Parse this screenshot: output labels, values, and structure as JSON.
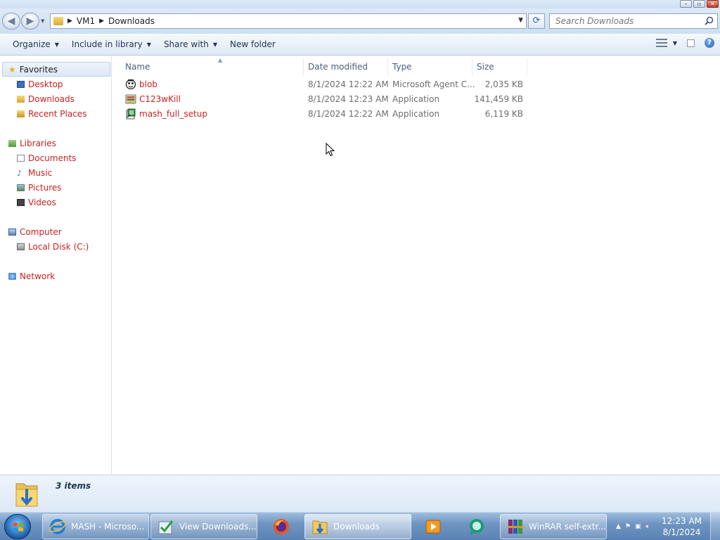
{
  "address": {
    "crumbs": [
      "VM1",
      "Downloads"
    ]
  },
  "search": {
    "placeholder": "Search Downloads"
  },
  "toolbar": {
    "organize": "Organize",
    "include_in_library": "Include in library",
    "share_with": "Share with",
    "new_folder": "New folder"
  },
  "nav": {
    "favorites": "Favorites",
    "desktop": "Desktop",
    "downloads": "Downloads",
    "recent_places": "Recent Places",
    "libraries": "Libraries",
    "documents": "Documents",
    "music": "Music",
    "pictures": "Pictures",
    "videos": "Videos",
    "computer": "Computer",
    "local_disk": "Local Disk (C:)",
    "network": "Network"
  },
  "columns": {
    "name": "Name",
    "date_modified": "Date modified",
    "type": "Type",
    "size": "Size"
  },
  "files": [
    {
      "name": "blob",
      "date": "8/1/2024 12:22 AM",
      "type": "Microsoft Agent C...",
      "size": "2,035 KB",
      "icon": "agent-character-icon"
    },
    {
      "name": "C123wKill",
      "date": "8/1/2024 12:23 AM",
      "type": "Application",
      "size": "141,459 KB",
      "icon": "app-icon"
    },
    {
      "name": "mash_full_setup",
      "date": "8/1/2024 12:22 AM",
      "type": "Application",
      "size": "6,119 KB",
      "icon": "installer-icon"
    }
  ],
  "details": {
    "count": "3 items"
  },
  "taskbar": {
    "buttons": [
      {
        "label": "MASH - Microso...",
        "icon": "internet-explorer-icon"
      },
      {
        "label": "View Downloads...",
        "icon": "downloads-check-icon"
      },
      {
        "label": "",
        "icon": "firefox-icon"
      },
      {
        "label": "Downloads",
        "icon": "folder-downloads-icon"
      },
      {
        "label": "",
        "icon": "media-player-icon"
      },
      {
        "label": "",
        "icon": "chat-icon"
      },
      {
        "label": "WinRAR self-extr...",
        "icon": "winrar-icon"
      }
    ],
    "time": "12:23 AM",
    "date": "8/1/2024"
  },
  "colors": {
    "link_red": "#cc1f1f",
    "taskbar_blue": "#6f95c2"
  }
}
